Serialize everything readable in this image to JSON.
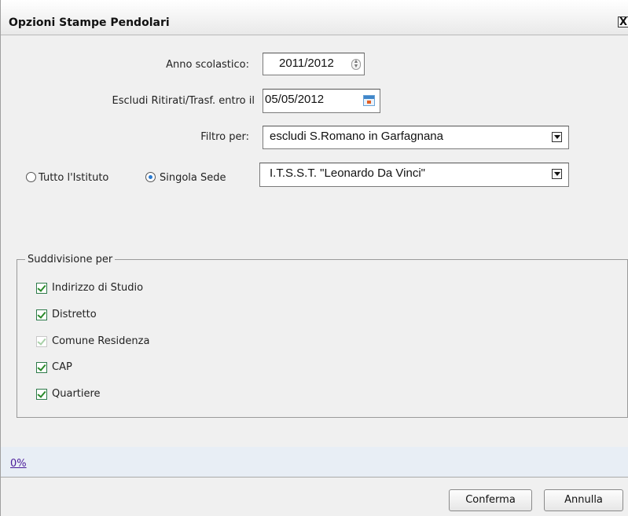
{
  "dialog": {
    "title": "Opzioni Stampe Pendolari",
    "close_label": "X"
  },
  "form": {
    "anno_label": "Anno scolastico:",
    "anno_value": "2011/2012",
    "escludi_label": "Escludi Ritirati/Trasf. entro il",
    "escludi_value": "05/05/2012",
    "filtro_label": "Filtro per:",
    "filtro_value": "escludi S.Romano in Garfagnana",
    "radio_tutto_label": "Tutto l'Istituto",
    "radio_sede_label": "Singola Sede",
    "radio_selected": "Singola Sede",
    "sede_value": "I.T.S.S.T. \"Leonardo Da Vinci\""
  },
  "suddivisione": {
    "legend": "Suddivisione per",
    "items": [
      {
        "label": "Indirizzo di Studio",
        "checked": true,
        "enabled": true
      },
      {
        "label": "Distretto",
        "checked": true,
        "enabled": true
      },
      {
        "label": "Comune Residenza",
        "checked": true,
        "enabled": false
      },
      {
        "label": "CAP",
        "checked": true,
        "enabled": true
      },
      {
        "label": "Quartiere",
        "checked": true,
        "enabled": true
      }
    ]
  },
  "progress": {
    "text": "0%",
    "value": 0
  },
  "buttons": {
    "confirm": "Conferma",
    "cancel": "Annulla"
  },
  "icons": {
    "spinner": "spinner-updown-icon",
    "calendar": "calendar-icon",
    "dropdown": "chevron-down-icon",
    "check": "check-icon"
  }
}
